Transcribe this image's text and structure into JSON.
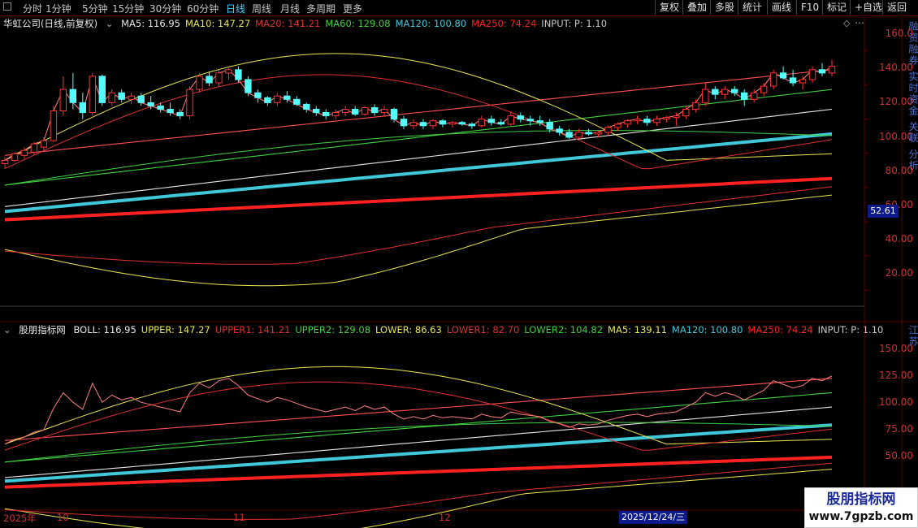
{
  "toolbar": {
    "tabs": [
      "分时",
      "1分钟",
      "5分钟",
      "15分钟",
      "30分钟",
      "60分钟",
      "日线",
      "周线",
      "月线",
      "多周期",
      "更多"
    ],
    "active_tab": "日线",
    "right_buttons": [
      "复权",
      "叠加",
      "多股",
      "统计",
      "画线",
      "F10",
      "标记",
      "+自选",
      "返回"
    ]
  },
  "main_panel": {
    "stock_title": "华虹公司(日线,前复权)",
    "indicators": [
      {
        "label": "MA5: 116.95",
        "color": "#e8e8e8"
      },
      {
        "label": "MA10: 147.27",
        "color": "#e8e850"
      },
      {
        "label": "MA20: 141.21",
        "color": "#e03030"
      },
      {
        "label": "MA60: 129.08",
        "color": "#40d040"
      },
      {
        "label": "MA120: 100.80",
        "color": "#40c8d8"
      },
      {
        "label": "MA250: 74.24",
        "color": "#ff2020"
      },
      {
        "label": "INPUT:  P: 1.10",
        "color": "#c8c8c8"
      }
    ],
    "axis_labels": [
      "160.0",
      "140.00",
      "120.00",
      "100.00",
      "80.00",
      "60.00",
      "40.00",
      "20.00"
    ],
    "price_tag": "52.61",
    "side_text": "融资融券 实时资金 关联 分析"
  },
  "sub_panel": {
    "title": "股朋指标网",
    "indicators": [
      {
        "label": "BOLL: 116.95",
        "color": "#e8e8e8"
      },
      {
        "label": "UPPER: 147.27",
        "color": "#e8e850"
      },
      {
        "label": "UPPER1: 141.21",
        "color": "#e03030"
      },
      {
        "label": "UPPER2: 129.08",
        "color": "#40d040"
      },
      {
        "label": "LOWER: 86.63",
        "color": "#e8e850"
      },
      {
        "label": "LOWER1: 82.70",
        "color": "#e03030"
      },
      {
        "label": "LOWER2: 104.82",
        "color": "#40d040"
      },
      {
        "label": "MA5: 139.11",
        "color": "#e8e850"
      },
      {
        "label": "MA120: 100.80",
        "color": "#40c8d8"
      },
      {
        "label": "MA250: 74.24",
        "color": "#ff2020"
      },
      {
        "label": "INPUT:  P: 1.10",
        "color": "#c8c8c8"
      }
    ],
    "axis_labels": [
      "150.00",
      "125.00",
      "100.00",
      "75.00",
      "50.00"
    ],
    "side_text": "江苏"
  },
  "date_axis": {
    "labels": [
      "2025年",
      "10",
      "11",
      "12"
    ],
    "cursor_date": "2025/12/24/三"
  },
  "watermark": {
    "title": "股朋指标网",
    "url": "www.7gpzb.com"
  },
  "colors": {
    "background": "#000000",
    "up_candle": "#ff3232",
    "down_candle": "#54fcfc",
    "axis_text": "#d03030",
    "grid": "#5a0000"
  },
  "chart_data": {
    "type": "candlestick",
    "candles": [
      [
        83,
        87,
        80,
        85
      ],
      [
        85,
        90,
        84,
        89
      ],
      [
        88,
        93,
        86,
        91
      ],
      [
        90,
        96,
        88,
        95
      ],
      [
        93,
        99,
        91,
        97
      ],
      [
        97,
        118,
        96,
        115
      ],
      [
        115,
        136,
        112,
        128
      ],
      [
        128,
        138,
        116,
        120
      ],
      [
        120,
        126,
        110,
        114
      ],
      [
        114,
        138,
        112,
        136
      ],
      [
        136,
        137,
        118,
        120
      ],
      [
        120,
        128,
        118,
        126
      ],
      [
        126,
        128,
        120,
        122
      ],
      [
        122,
        126,
        119,
        124
      ],
      [
        124,
        126,
        118,
        120
      ],
      [
        120,
        124,
        116,
        118
      ],
      [
        118,
        120,
        114,
        116
      ],
      [
        116,
        120,
        112,
        114
      ],
      [
        114,
        116,
        110,
        112
      ],
      [
        112,
        130,
        110,
        128
      ],
      [
        128,
        138,
        126,
        136
      ],
      [
        136,
        139,
        130,
        132
      ],
      [
        132,
        140,
        130,
        138
      ],
      [
        138,
        141,
        134,
        140
      ],
      [
        140,
        142,
        132,
        134
      ],
      [
        134,
        136,
        124,
        126
      ],
      [
        126,
        128,
        120,
        123
      ],
      [
        123,
        124,
        118,
        120
      ],
      [
        120,
        126,
        118,
        124
      ],
      [
        124,
        127,
        120,
        122
      ],
      [
        122,
        124,
        118,
        119
      ],
      [
        119,
        120,
        114,
        116
      ],
      [
        116,
        118,
        112,
        114
      ],
      [
        114,
        116,
        110,
        112
      ],
      [
        112,
        116,
        110,
        114
      ],
      [
        114,
        118,
        112,
        116
      ],
      [
        116,
        118,
        112,
        113
      ],
      [
        113,
        118,
        112,
        117
      ],
      [
        117,
        119,
        112,
        114
      ],
      [
        114,
        118,
        112,
        116
      ],
      [
        116,
        117,
        108,
        110
      ],
      [
        110,
        112,
        104,
        106
      ],
      [
        106,
        110,
        104,
        108
      ],
      [
        108,
        110,
        104,
        106
      ],
      [
        106,
        110,
        104,
        109
      ],
      [
        109,
        110,
        105,
        107
      ],
      [
        107,
        109,
        105,
        108
      ],
      [
        108,
        109,
        106,
        107
      ],
      [
        107,
        108,
        104,
        106
      ],
      [
        106,
        112,
        105,
        110
      ],
      [
        110,
        112,
        106,
        108
      ],
      [
        108,
        110,
        106,
        107
      ],
      [
        107,
        114,
        106,
        112
      ],
      [
        112,
        114,
        108,
        110
      ],
      [
        110,
        112,
        106,
        109
      ],
      [
        109,
        112,
        106,
        108
      ],
      [
        108,
        110,
        102,
        104
      ],
      [
        104,
        106,
        100,
        102
      ],
      [
        102,
        104,
        98,
        99
      ],
      [
        99,
        104,
        98,
        102
      ],
      [
        102,
        104,
        100,
        101
      ],
      [
        101,
        103,
        99,
        102
      ],
      [
        102,
        106,
        100,
        105
      ],
      [
        105,
        108,
        103,
        107
      ],
      [
        107,
        110,
        105,
        109
      ],
      [
        109,
        112,
        107,
        110
      ],
      [
        110,
        112,
        106,
        108
      ],
      [
        108,
        112,
        106,
        110
      ],
      [
        110,
        112,
        108,
        111
      ],
      [
        111,
        114,
        106,
        112
      ],
      [
        112,
        118,
        110,
        116
      ],
      [
        116,
        122,
        114,
        120
      ],
      [
        120,
        132,
        118,
        128
      ],
      [
        128,
        130,
        122,
        125
      ],
      [
        125,
        130,
        122,
        128
      ],
      [
        128,
        130,
        124,
        126
      ],
      [
        126,
        128,
        118,
        122
      ],
      [
        122,
        128,
        120,
        126
      ],
      [
        126,
        132,
        124,
        130
      ],
      [
        130,
        140,
        128,
        138
      ],
      [
        138,
        142,
        134,
        135
      ],
      [
        135,
        140,
        130,
        132
      ],
      [
        132,
        136,
        128,
        134
      ],
      [
        134,
        142,
        132,
        140
      ],
      [
        140,
        144,
        136,
        138
      ],
      [
        138,
        146,
        136,
        142
      ]
    ],
    "ylim_main": [
      0,
      165
    ],
    "ylim_sub": [
      25,
      165
    ],
    "ma_series": [
      {
        "values_start": 88,
        "values_end": 140,
        "color": "#ff5050"
      },
      {
        "values_start": 70,
        "values_end": 128,
        "color": "#40d040"
      },
      {
        "values_start": 57,
        "values_end": 116,
        "color": "#e8e8e8"
      },
      {
        "values_start": 54,
        "values_end": 101,
        "color": "#40c8d8"
      },
      {
        "values_start": 49,
        "values_end": 74,
        "color": "#ff2020"
      }
    ]
  }
}
